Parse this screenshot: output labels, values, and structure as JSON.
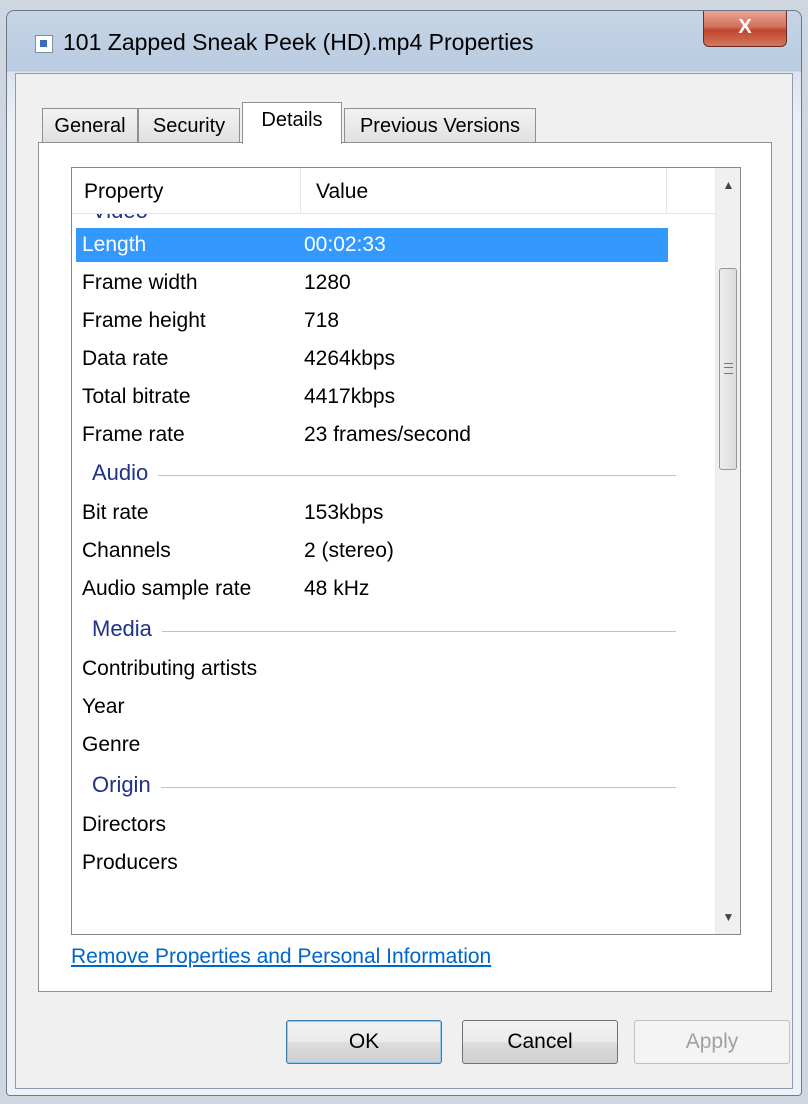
{
  "window": {
    "title": "101 Zapped Sneak Peek (HD).mp4 Properties",
    "close_label": "X"
  },
  "tabs": [
    {
      "label": "General"
    },
    {
      "label": "Security"
    },
    {
      "label": "Details"
    },
    {
      "label": "Previous Versions"
    }
  ],
  "list": {
    "header": {
      "property": "Property",
      "value": "Value"
    },
    "partial_group": "Video",
    "rows": [
      {
        "k": "Length",
        "v": "00:02:33",
        "selected": true
      },
      {
        "k": "Frame width",
        "v": "1280"
      },
      {
        "k": "Frame height",
        "v": "718"
      },
      {
        "k": "Data rate",
        "v": "4264kbps"
      },
      {
        "k": "Total bitrate",
        "v": "4417kbps"
      },
      {
        "k": "Frame rate",
        "v": "23 frames/second"
      }
    ],
    "audio_group": "Audio",
    "audio_rows": [
      {
        "k": "Bit rate",
        "v": "153kbps"
      },
      {
        "k": "Channels",
        "v": "2 (stereo)"
      },
      {
        "k": "Audio sample rate",
        "v": "48 kHz"
      }
    ],
    "media_group": "Media",
    "media_rows": [
      {
        "k": "Contributing artists",
        "v": ""
      },
      {
        "k": "Year",
        "v": ""
      },
      {
        "k": "Genre",
        "v": ""
      }
    ],
    "origin_group": "Origin",
    "origin_rows": [
      {
        "k": "Directors",
        "v": ""
      },
      {
        "k": "Producers",
        "v": ""
      }
    ]
  },
  "link_text": "Remove Properties and Personal Information",
  "buttons": {
    "ok": "OK",
    "cancel": "Cancel",
    "apply": "Apply"
  },
  "colors": {
    "selection": "#3399ff",
    "group_text": "#1e3287",
    "link": "#0066cc"
  }
}
